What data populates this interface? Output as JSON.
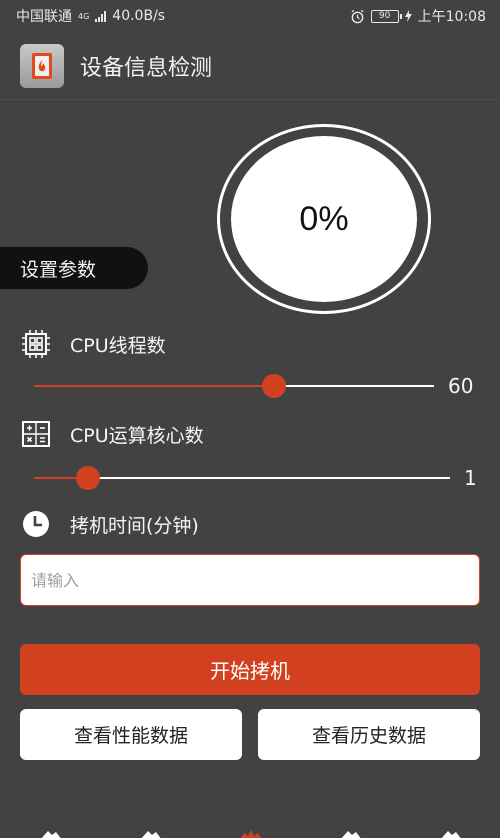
{
  "statusbar": {
    "carrier": "中国联通",
    "network": "4G",
    "speed": "40.0B/s",
    "battery": "90",
    "time": "上午10:08"
  },
  "appbar": {
    "title": "设备信息检测",
    "logo_icon": "flame-card-icon"
  },
  "gauge": {
    "value": "0%"
  },
  "settings": {
    "tag": "设置参数",
    "cpu_threads": {
      "label": "CPU线程数",
      "value": "60",
      "fraction": 0.6,
      "icon": "cpu-chip-icon"
    },
    "cpu_cores": {
      "label": "CPU运算核心数",
      "value": "1",
      "fraction": 0.13,
      "icon": "calculator-icon"
    },
    "burn_time": {
      "label": "拷机时间(分钟)",
      "placeholder": "请输入",
      "icon": "clock-icon"
    }
  },
  "buttons": {
    "start": "开始拷机",
    "performance": "查看性能数据",
    "history": "查看历史数据"
  },
  "colors": {
    "accent": "#d1411f",
    "background": "#424242",
    "tag_bg": "#111111"
  },
  "tabbar": {
    "icons": [
      "tab-icon-1",
      "tab-icon-2",
      "tab-icon-3-active",
      "tab-icon-4",
      "tab-icon-5"
    ]
  }
}
